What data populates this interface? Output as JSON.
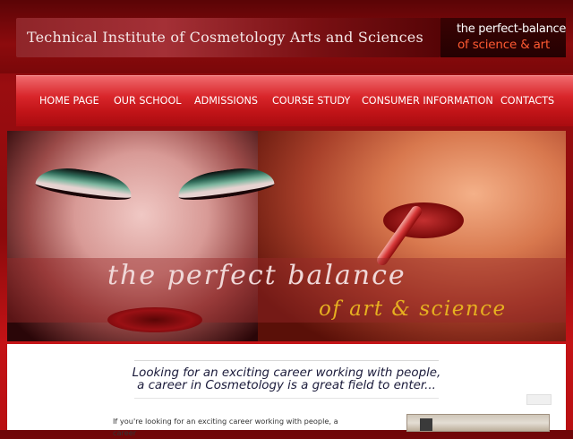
{
  "header": {
    "site_title": "Technical Institute of Cosmetology Arts and Sciences",
    "tagline_line1": "the perfect-balance",
    "tagline_line2": "of science & art",
    "tagline_accent_color": "#ff5a32"
  },
  "nav": {
    "items": [
      {
        "label": "HOME PAGE"
      },
      {
        "label": "OUR SCHOOL"
      },
      {
        "label": "ADMISSIONS"
      },
      {
        "label": "COURSE STUDY"
      },
      {
        "label": "CONSUMER INFORMATION"
      },
      {
        "label": "CONTACTS"
      }
    ]
  },
  "banner": {
    "line1": "the perfect balance",
    "line2": "of art & science",
    "line2_color": "#e6b020"
  },
  "main": {
    "intro_line1": "Looking for an exciting career working with people,",
    "intro_line2": "a career in Cosmetology is a great field to enter...",
    "body_text": "If you're looking for an exciting career working with people, a career"
  },
  "theme": {
    "brand_red": "#c41316",
    "dark_red": "#6e0608"
  }
}
